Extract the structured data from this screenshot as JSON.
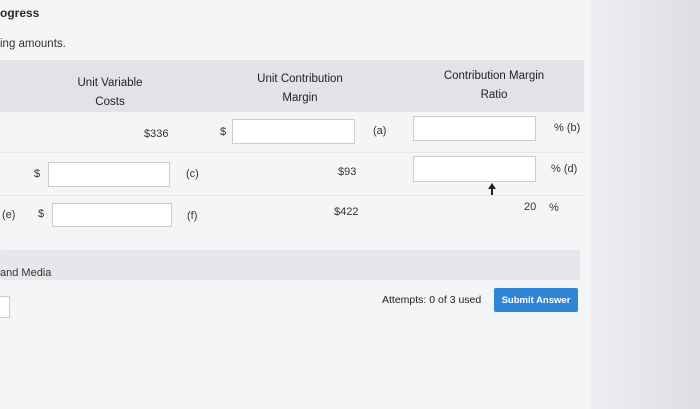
{
  "header": {
    "title": "ogress",
    "subtitle": "ing amounts."
  },
  "table": {
    "columns": {
      "unit_variable_costs": [
        "Unit Variable",
        "Costs"
      ],
      "unit_contribution_margin": [
        "Unit Contribution",
        "Margin"
      ],
      "contribution_margin_ratio": [
        "Contribution Margin",
        "Ratio"
      ]
    },
    "row1": {
      "variable_cost": "$336",
      "dollar": "$",
      "margin_tag": "(a)",
      "ratio_suffix": "% (b)"
    },
    "row2": {
      "dollar": "$",
      "cost_tag": "(c)",
      "margin": "$93",
      "ratio_suffix": "% (d)"
    },
    "row3": {
      "row_tag": "(e)",
      "dollar": "$",
      "cost_tag": "(f)",
      "margin": "$422",
      "ratio": "20",
      "percent": "%"
    }
  },
  "section": {
    "label": "and Media"
  },
  "footer": {
    "attempts": "Attempts: 0 of 3 used",
    "submit_label": "Submit Answer"
  },
  "colors": {
    "submit_button": "#2f86d6"
  }
}
